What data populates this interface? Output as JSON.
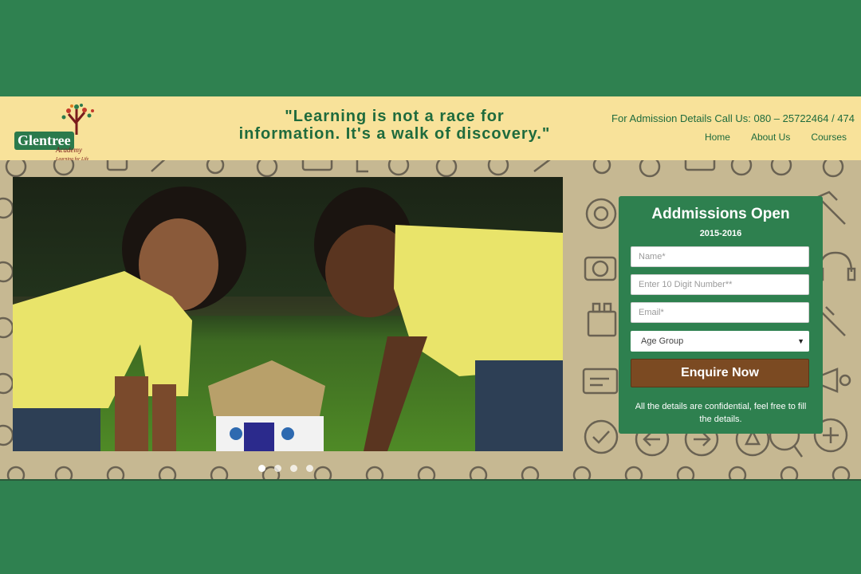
{
  "header": {
    "logo": {
      "name": "Glentree",
      "sub": "Academy",
      "tagline": "Learning for Life"
    },
    "quote_line1": "\"Learning is not a race for",
    "quote_line2": "information. It's a walk of discovery.\"",
    "call_us": "For Admission Details Call Us: 080 – 25722464 / 474",
    "nav": {
      "home": "Home",
      "about": "About Us",
      "courses": "Courses"
    }
  },
  "carousel": {
    "slides": 4,
    "active": 0
  },
  "form": {
    "title": "Addmissions Open",
    "year": "2015-2016",
    "name_placeholder": "Name*",
    "phone_placeholder": "Enter 10 Digit Number**",
    "email_placeholder": "Email*",
    "age_group": "Age Group",
    "submit": "Enquire Now",
    "note": "All the details are confidential, feel free to fill the details."
  },
  "colors": {
    "brand_green": "#2f8150",
    "header_bg": "#f8e29a",
    "button": "#7b4a22",
    "pattern_bg": "#c6b892"
  }
}
